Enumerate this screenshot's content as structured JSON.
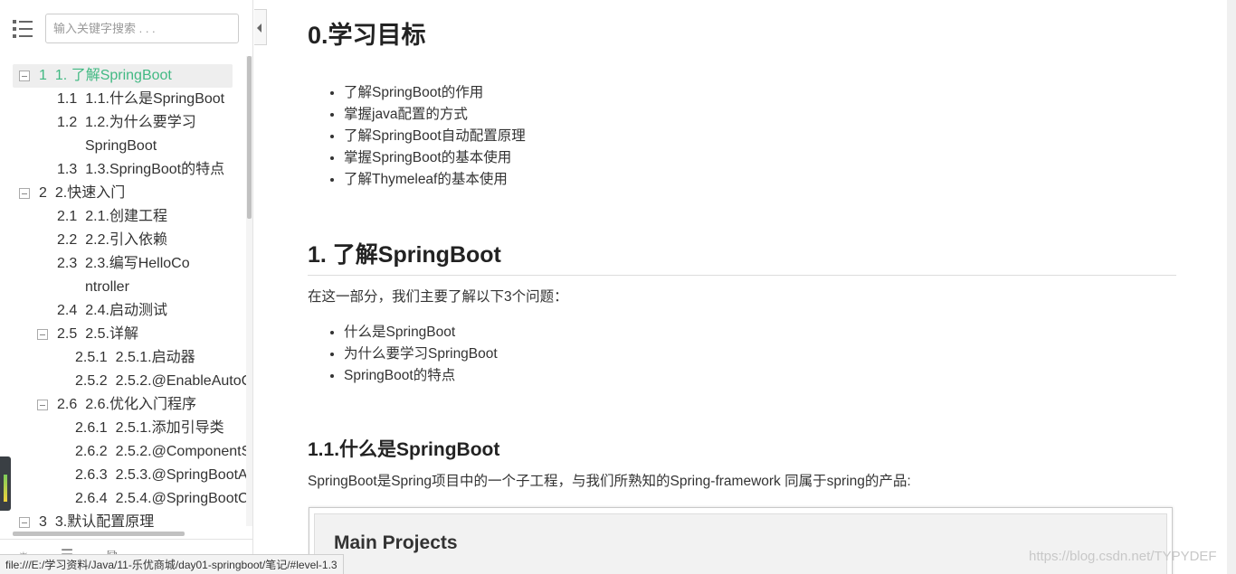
{
  "sidebar": {
    "search_placeholder": "输入关键字搜索 . . .",
    "toc": [
      {
        "num": "1",
        "text": "1. 了解SpringBoot",
        "level": 1,
        "active": true,
        "collapsible": true
      },
      {
        "num": "1.1",
        "text": "1.1.什么是SpringBoot",
        "level": 2
      },
      {
        "num": "1.2",
        "text": "1.2.为什么要学习SpringBoot",
        "level": 2
      },
      {
        "num": "1.3",
        "text": "1.3.SpringBoot的特点",
        "level": 2
      },
      {
        "num": "2",
        "text": "2.快速入门",
        "level": 1,
        "collapsible": true
      },
      {
        "num": "2.1",
        "text": "2.1.创建工程",
        "level": 2
      },
      {
        "num": "2.2",
        "text": "2.2.引入依赖",
        "level": 2
      },
      {
        "num": "2.3",
        "text": "2.3.编写HelloController",
        "level": 2
      },
      {
        "num": "2.4",
        "text": "2.4.启动测试",
        "level": 2
      },
      {
        "num": "2.5",
        "text": "2.5.详解",
        "level": 2,
        "collapsible": true
      },
      {
        "num": "2.5.1",
        "text": "2.5.1.启动器",
        "level": 3
      },
      {
        "num": "2.5.2",
        "text": "2.5.2.@EnableAutoC",
        "level": 3
      },
      {
        "num": "2.6",
        "text": "2.6.优化入门程序",
        "level": 2,
        "collapsible": true
      },
      {
        "num": "2.6.1",
        "text": "2.5.1.添加引导类",
        "level": 3
      },
      {
        "num": "2.6.2",
        "text": "2.5.2.@ComponentS",
        "level": 3
      },
      {
        "num": "2.6.3",
        "text": "2.5.3.@SpringBootA",
        "level": 3
      },
      {
        "num": "2.6.4",
        "text": "2.5.4.@SpringBootC",
        "level": 3
      },
      {
        "num": "3",
        "text": "3.默认配置原理",
        "level": 1,
        "collapsible": true
      }
    ],
    "footer_icons": [
      "sun-icon",
      "list-icon",
      "link-icon"
    ]
  },
  "content": {
    "goals_title": "0.学习目标",
    "goals": [
      "了解SpringBoot的作用",
      "掌握java配置的方式",
      "了解SpringBoot自动配置原理",
      "掌握SpringBoot的基本使用",
      "了解Thymeleaf的基本使用"
    ],
    "section1_title": "1. 了解SpringBoot",
    "section1_intro": "在这一部分，我们主要了解以下3个问题：",
    "section1_items": [
      "什么是SpringBoot",
      "为什么要学习SpringBoot",
      "SpringBoot的特点"
    ],
    "sub11_title": "1.1.什么是SpringBoot",
    "sub11_para": "SpringBoot是Spring项目中的一个子工程，与我们所熟知的Spring-framework 同属于spring的产品:",
    "embedded_title": "Main Projects"
  },
  "watermark": "https://blog.csdn.net/TYPYDEF",
  "status_bar": "file:///E:/学习资料/Java/11-乐优商城/day01-springboot/笔记/#level-1.3",
  "colors": {
    "active": "#42b983"
  }
}
